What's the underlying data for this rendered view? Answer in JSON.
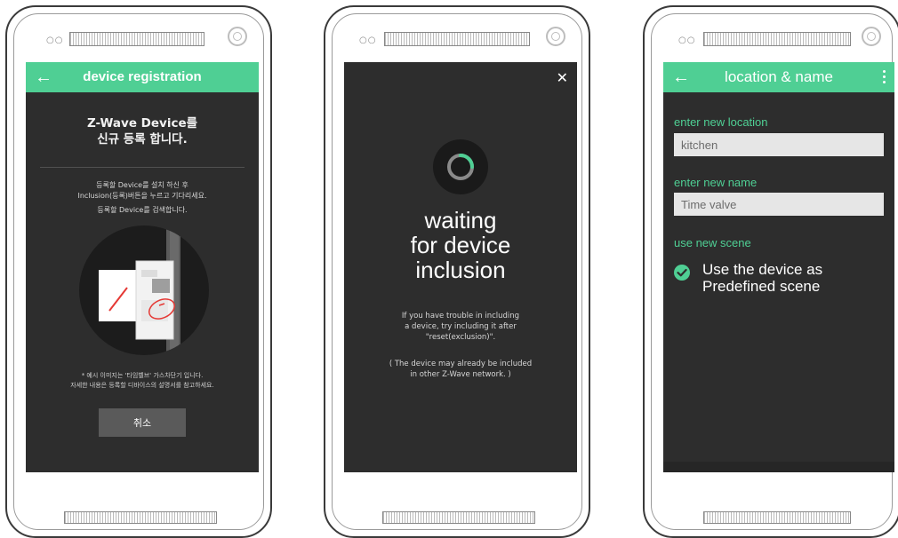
{
  "phone1": {
    "header_title": "device registration",
    "back_icon": "arrow-left-icon",
    "heading_lines": [
      "Z-Wave Device를",
      "신규 등록 합니다."
    ],
    "description_lines": [
      "등록할 Device를 설치 하신 후",
      "Inclusion(등록)버튼을 누르고 기다리세요.",
      "등록할 Device를 검색합니다."
    ],
    "note_lines": [
      "* 예시 이미지는 '타임벨브' 가스차단기 입니다.",
      "자세한 내용은 등록할 디바이스의 설명서를 참고하세요."
    ],
    "cancel_label": "취소"
  },
  "phone2": {
    "close_icon": "close-icon",
    "waiting_lines": [
      "waiting",
      "for device",
      "inclusion"
    ],
    "trouble_lines": [
      "If you have trouble in including",
      "a device, try including it after",
      "\"reset(exclusion)\"."
    ],
    "already_lines": [
      "( The device may already be included",
      "in other Z-Wave network. )"
    ]
  },
  "phone3": {
    "header_title": "location & name",
    "location_label": "enter new location",
    "location_value": "kitchen",
    "name_label": "enter new name",
    "name_value": "Time valve",
    "scene_label": "use new scene",
    "scene_option_lines": [
      "Use the device as",
      "Predefined scene"
    ],
    "scene_checked": true
  },
  "colors": {
    "accent": "#4fcf94",
    "screen_bg": "#2d2d2d",
    "cancel_bg": "#5a5a5a",
    "input_bg": "#e6e6e6"
  }
}
